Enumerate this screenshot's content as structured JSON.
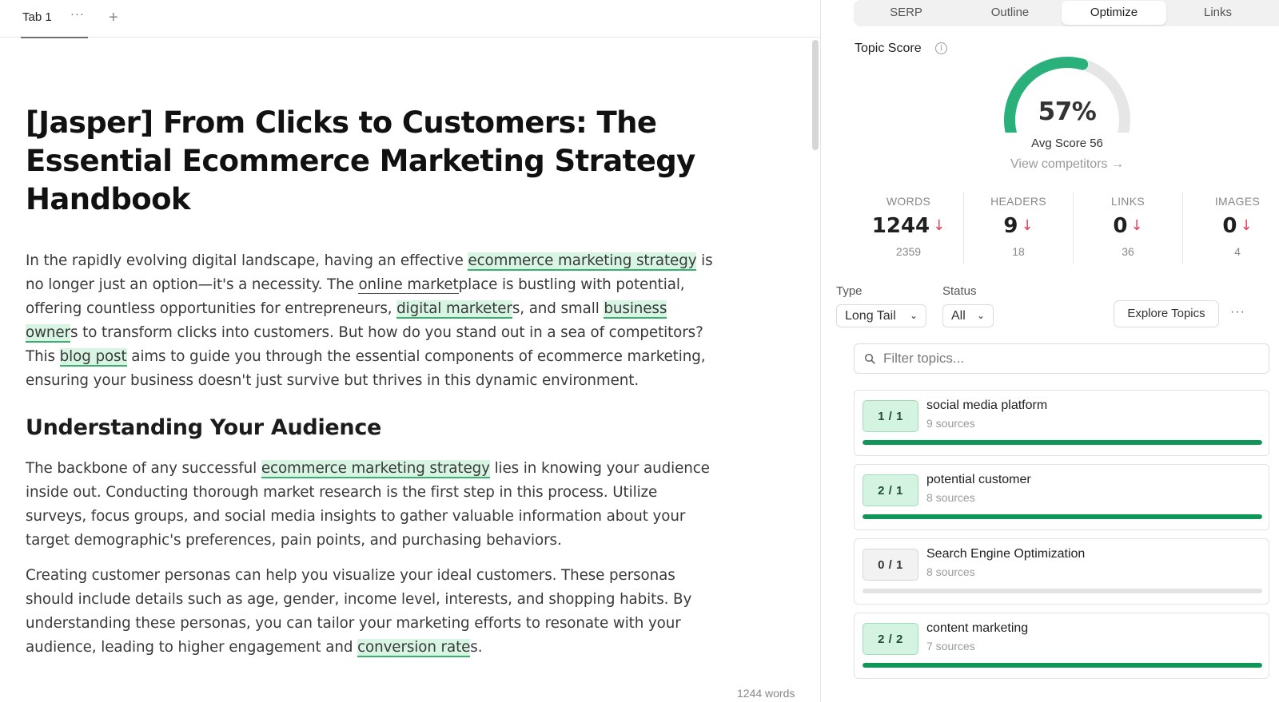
{
  "editor": {
    "tab_label": "Tab 1",
    "tab_more": "···",
    "tab_add": "+",
    "title": "[Jasper] From Clicks to Customers: The Essential Ecommerce Marketing Strategy Handbook",
    "p1": {
      "a": "In the rapidly evolving digital landscape, having an effective ",
      "h1": "ecommerce marketing strategy",
      "b": " is no longer just an option—it's a necessity. The ",
      "u1": "online market",
      "c": "place is bustling with potential, offering countless opportunities for entrepreneurs, ",
      "h2": "digital marketer",
      "d": "s, and small ",
      "h3": "business owner",
      "e": "s to transform clicks into customers. But how do you stand out in a sea of competitors? This ",
      "h4": "blog post",
      "f": " aims to guide you through the essential components of ecommerce marketing, ensuring your business doesn't just survive but thrives in this dynamic environment."
    },
    "h2": "Understanding Your Audience",
    "p2": {
      "a": "The backbone of any successful ",
      "h1": "ecommerce marketing strategy",
      "b": " lies in knowing your audience inside out. Conducting thorough market research is the first step in this process. Utilize surveys, focus groups, and social media insights to gather valuable information about your target demographic's preferences, pain points, and purchasing behaviors."
    },
    "p3": {
      "a": "Creating customer personas can help you visualize your ideal customers. These personas should include details such as age, gender, income level, interests, and shopping habits. By understanding these personas, you can tailor your marketing efforts to resonate with your audience, leading to higher engagement and ",
      "h1": "conversion rate",
      "b": "s."
    },
    "word_count": "1244 words"
  },
  "panel": {
    "tabs": [
      "SERP",
      "Outline",
      "Optimize",
      "Links"
    ],
    "active_tab": "Optimize",
    "topic_score_label": "Topic Score",
    "info_icon": "i",
    "score": 57,
    "score_text": "57%",
    "avg_score": "Avg Score 56",
    "view_competitors": "View competitors →",
    "stats": [
      {
        "label": "WORDS",
        "value": "1244",
        "target": "2359",
        "trend": "↓"
      },
      {
        "label": "HEADERS",
        "value": "9",
        "target": "18",
        "trend": "↓"
      },
      {
        "label": "LINKS",
        "value": "0",
        "target": "36",
        "trend": "↓"
      },
      {
        "label": "IMAGES",
        "value": "0",
        "target": "4",
        "trend": "↓"
      }
    ],
    "type_label": "Type",
    "type_value": "Long Tail",
    "status_label": "Status",
    "status_value": "All",
    "explore_label": "Explore Topics",
    "kebab": "···",
    "filter_placeholder": "Filter topics...",
    "topics": [
      {
        "badge": "1 / 1",
        "name": "social media platform",
        "sources": "9 sources",
        "fill": 1.0
      },
      {
        "badge": "2 / 1",
        "name": "potential customer",
        "sources": "8 sources",
        "fill": 1.0
      },
      {
        "badge": "0 / 1",
        "name": "Search Engine Optimization",
        "sources": "8 sources",
        "fill": 0.0
      },
      {
        "badge": "2 / 2",
        "name": "content marketing",
        "sources": "7 sources",
        "fill": 1.0
      }
    ],
    "colors": {
      "accent": "#11965a",
      "gauge": "#2ab07a",
      "down": "#e0425a"
    }
  }
}
